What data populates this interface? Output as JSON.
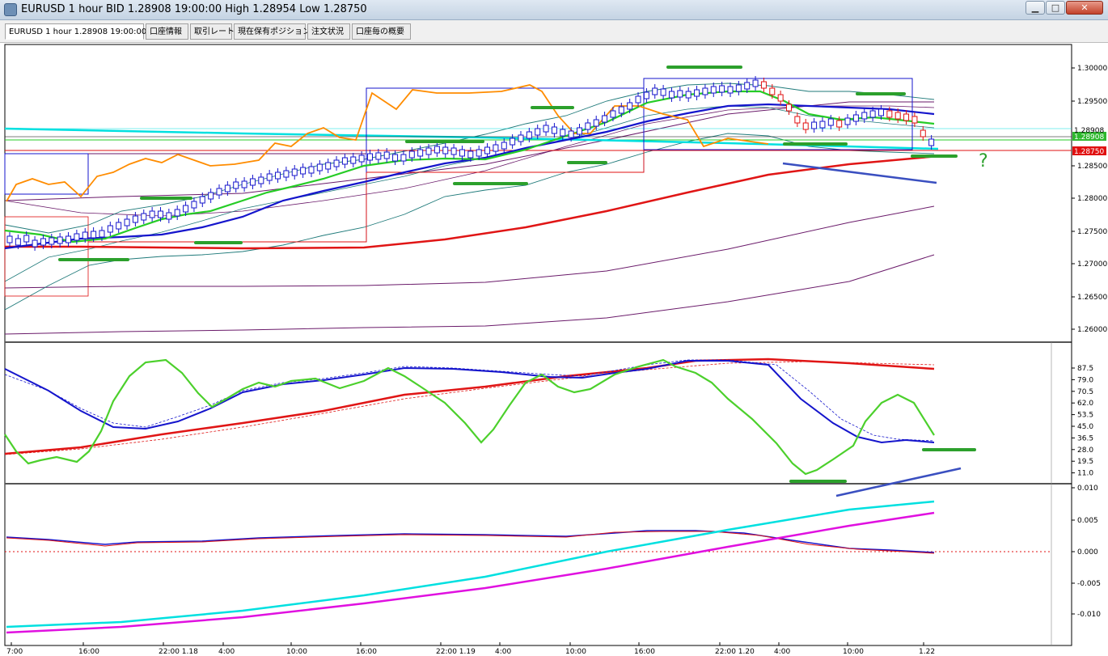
{
  "window": {
    "title": "EURUSD 1 hour BID 1.28908 19:00:00 High 1.28954 Low 1.28750",
    "buttons": {
      "minimize": "▁",
      "maximize": "□",
      "close": "✕"
    }
  },
  "tabs": [
    {
      "label": "EURUSD 1 hour 1.28908 19:00:00",
      "active": true
    },
    {
      "label": "口座情報"
    },
    {
      "label": "取引レート"
    },
    {
      "label": "現在保有ポジション"
    },
    {
      "label": "注文状況"
    },
    {
      "label": "口座毎の概要"
    }
  ],
  "icons": {
    "app": "app-icon"
  },
  "price_panel": {
    "price_ticks": [
      "1.30000",
      "1.29500",
      "1.28500",
      "1.28000",
      "1.27500",
      "1.27000",
      "1.26500",
      "1.26000"
    ],
    "current_price_label": "1.28908",
    "current_price_color": "#2eb82e",
    "low_label": "1.28750",
    "low_label_color": "#e01010",
    "overlap_label": "1.28908",
    "question_mark": "?"
  },
  "oscillator_panel": {
    "ticks": [
      "87.5",
      "79.0",
      "70.5",
      "62.0",
      "53.5",
      "45.0",
      "36.5",
      "28.0",
      "19.5",
      "11.0"
    ]
  },
  "macd_panel": {
    "ticks": [
      "0.010",
      "0.005",
      "0.000",
      "-0.005",
      "-0.010"
    ]
  },
  "time_axis": {
    "labels": [
      "7:00",
      "16:00",
      "22:00 1.18",
      "4:00",
      "10:00",
      "16:00",
      "22:00 1.19",
      "4:00",
      "10:00",
      "16:00",
      "22:00 1.20",
      "4:00",
      "10:00",
      "1.22"
    ]
  },
  "colors": {
    "bollinger": "#1f7a7a",
    "envelope": "#6a1a6a",
    "ma_fast": "#26cc26",
    "ma_mid": "#1515cc",
    "ma_slow": "#e01515",
    "ichimoku": "#ff8c00",
    "cyan": "#00e0e0",
    "magenta": "#e010e0"
  }
}
